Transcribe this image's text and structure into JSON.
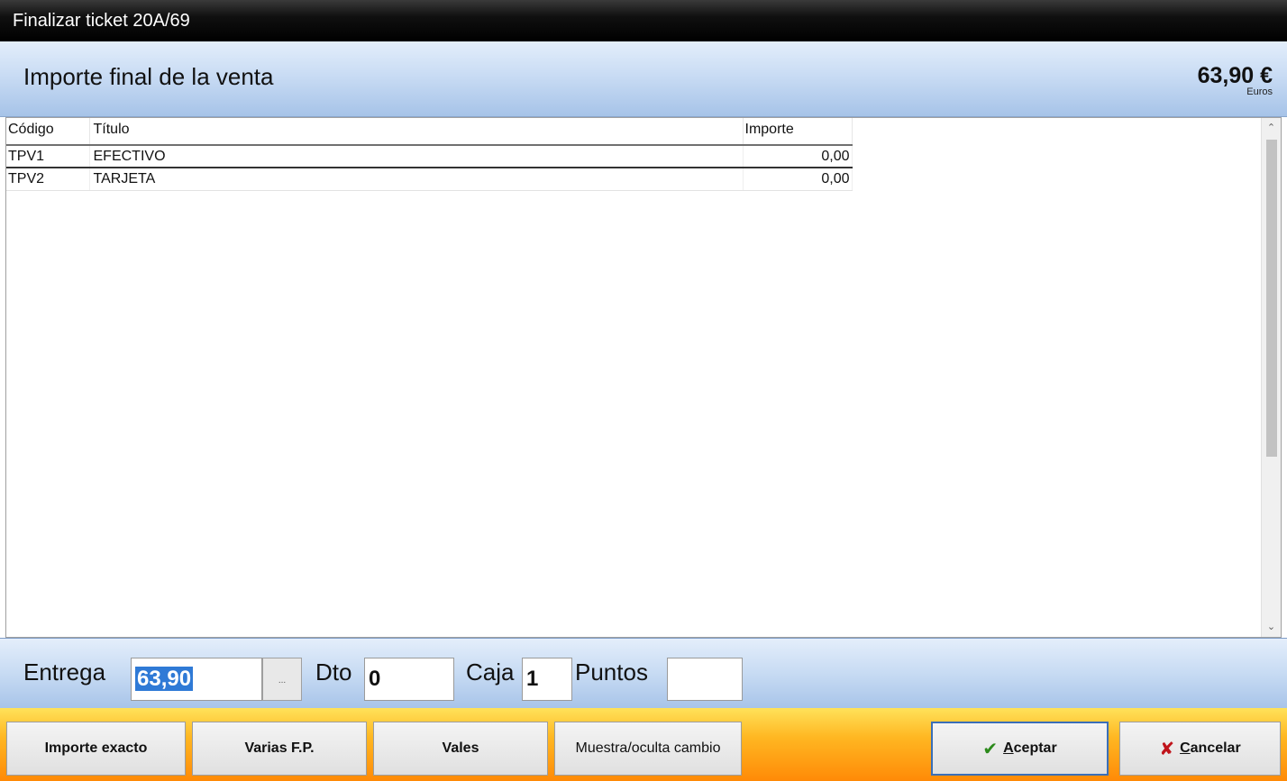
{
  "window": {
    "title": "Finalizar ticket 20A/69"
  },
  "header": {
    "title": "Importe final de la venta",
    "amount": "63,90 €",
    "unit": "Euros"
  },
  "grid": {
    "columns": {
      "code": "Código",
      "title": "Título",
      "amount": "Importe"
    },
    "rows": [
      {
        "code": "TPV1",
        "title": "EFECTIVO",
        "amount": "0,00"
      },
      {
        "code": "TPV2",
        "title": "TARJETA",
        "amount": "0,00"
      }
    ]
  },
  "scrollbar": {
    "up_icon": "⌃",
    "down_icon": "⌄"
  },
  "entry": {
    "entrega_label": "Entrega",
    "entrega_value": "63,90",
    "dots_label": "...",
    "dto_label": "Dto",
    "dto_value": "0",
    "caja_label": "Caja",
    "caja_value": "1",
    "puntos_label": "Puntos",
    "puntos_value": ""
  },
  "buttons": {
    "importe_exacto": "Importe exacto",
    "varias_fp": "Varias F.P.",
    "vales": "Vales",
    "muestra_cambio": "Muestra/oculta cambio",
    "aceptar_first": "A",
    "aceptar_rest": "ceptar",
    "cancelar_first": "C",
    "cancelar_rest": "ancelar"
  },
  "colors": {
    "accent": "#2f7ad6",
    "button_bar": "#ffb722",
    "accept_icon": "#2c8a1c",
    "cancel_icon": "#c0141b"
  }
}
